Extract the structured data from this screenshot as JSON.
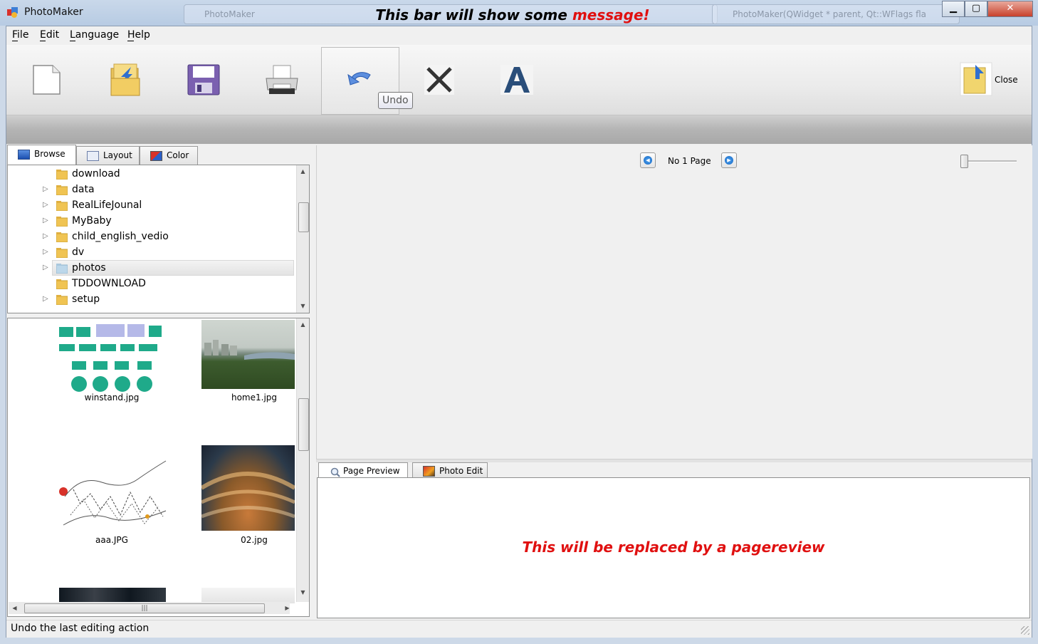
{
  "window": {
    "title": "PhotoMaker",
    "background_windows": [
      "PhotoMaker",
      "PhotoMaker(QWidget * parent, Qt::WFlags fla"
    ],
    "controls": {
      "minimize": "▁",
      "maximize": "▢",
      "close": "✕"
    }
  },
  "menu": {
    "items": [
      {
        "label": "File",
        "mnemonic": "F"
      },
      {
        "label": "Edit",
        "mnemonic": "E"
      },
      {
        "label": "Language",
        "mnemonic": "L"
      },
      {
        "label": "Help",
        "mnemonic": "H"
      }
    ]
  },
  "toolbar": {
    "tools": [
      {
        "name": "new",
        "icon": "new-page-icon"
      },
      {
        "name": "open",
        "icon": "open-folder-icon"
      },
      {
        "name": "save",
        "icon": "floppy-disk-icon"
      },
      {
        "name": "print",
        "icon": "printer-icon"
      },
      {
        "name": "undo",
        "icon": "undo-arrow-icon",
        "tooltip": "Undo"
      },
      {
        "name": "delete",
        "icon": "x-cross-icon"
      },
      {
        "name": "text",
        "icon": "letter-a-icon"
      }
    ],
    "close_label": "Close",
    "undo_tooltip": "Undo"
  },
  "message_bar": {
    "text": "This bar will show some ",
    "accent": "message!",
    "accent_color": "#e01010"
  },
  "left_tabs": [
    {
      "label": "Browse",
      "active": true
    },
    {
      "label": "Layout",
      "active": false
    },
    {
      "label": "Color",
      "active": false
    }
  ],
  "tree": {
    "items": [
      {
        "label": "download",
        "expandable": false,
        "selected": false
      },
      {
        "label": "data",
        "expandable": true,
        "selected": false
      },
      {
        "label": "RealLifeJounal",
        "expandable": true,
        "selected": false
      },
      {
        "label": "MyBaby",
        "expandable": true,
        "selected": false
      },
      {
        "label": "child_english_vedio",
        "expandable": true,
        "selected": false
      },
      {
        "label": "dv",
        "expandable": true,
        "selected": false
      },
      {
        "label": "photos",
        "expandable": true,
        "selected": true
      },
      {
        "label": "TDDOWNLOAD",
        "expandable": false,
        "selected": false
      },
      {
        "label": "setup",
        "expandable": true,
        "selected": false
      }
    ]
  },
  "thumbnails": [
    {
      "filename": "winstand.jpg"
    },
    {
      "filename": "home1.jpg"
    },
    {
      "filename": "aaa.JPG"
    },
    {
      "filename": "02.jpg"
    }
  ],
  "page_nav": {
    "label": "No 1 Page",
    "prev_icon": "previous-page-icon",
    "next_icon": "next-page-icon"
  },
  "bottom_tabs": [
    {
      "label": "Page Preview",
      "active": true
    },
    {
      "label": "Photo Edit",
      "active": false
    }
  ],
  "preview": {
    "placeholder": "This will be replaced by a pagereview"
  },
  "status": {
    "text": "Undo the last editing action"
  },
  "colors": {
    "accent_red": "#e01010",
    "window_chrome": "#c9d8ea"
  }
}
